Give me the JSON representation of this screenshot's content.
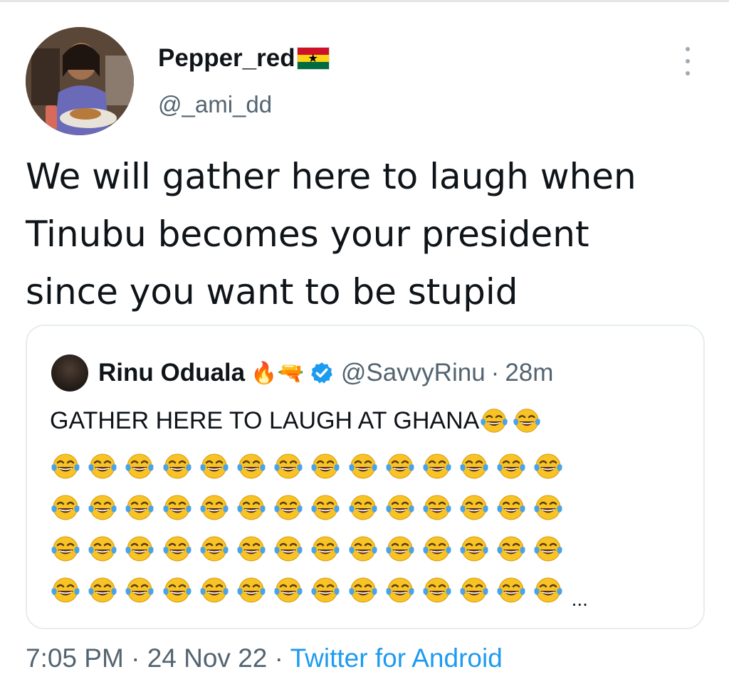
{
  "author": {
    "display_name": "Pepper_red",
    "handle": "@_ami_dd",
    "flag_icon": "ghana-flag-icon"
  },
  "tweet": {
    "lines": [
      "We will gather here to laugh when",
      "Tinubu becomes your president",
      "since you want to be stupid"
    ]
  },
  "quoted_tweet": {
    "display_name": "Rinu Oduala",
    "name_emojis": "🔥🔫",
    "handle": "@SavvyRinu",
    "separator": "·",
    "time": "28m",
    "text": "GATHER HERE TO LAUGH AT GHANA",
    "emoji_name": "face-with-tears-of-joy-icon",
    "emoji_rows": [
      14,
      14,
      14,
      14
    ],
    "truncation": "..."
  },
  "footer": {
    "time": "7:05 PM",
    "separator": "·",
    "date": "24 Nov 22",
    "source": "Twitter for Android"
  },
  "colors": {
    "text_primary": "#0f1419",
    "text_secondary": "#536471",
    "link": "#1d9bf0",
    "verified": "#1d9bf0"
  }
}
